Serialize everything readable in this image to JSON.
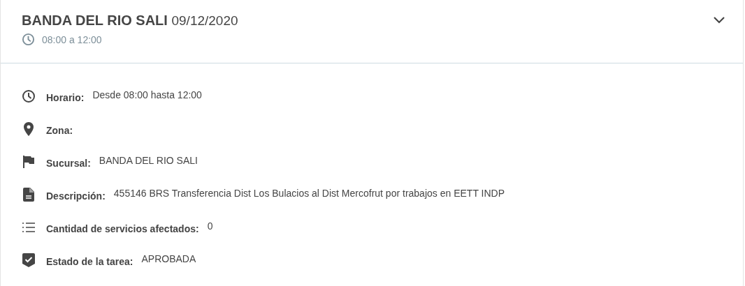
{
  "panel": {
    "title": "BANDA DEL RIO SALI",
    "date": "09/12/2020",
    "time": "08:00 a 12:00",
    "expanded": true
  },
  "details": [
    {
      "kind": "clock",
      "label": "Horario:",
      "value": "Desde 08:00 hasta 12:00"
    },
    {
      "kind": "pin",
      "label": "Zona:"
    },
    {
      "kind": "flag",
      "label": "Sucursal:",
      "value": "BANDA DEL RIO SALI"
    },
    {
      "kind": "document",
      "label": "Descripción:",
      "value": "455146 BRS Transferencia Dist Los Bulacios al Dist Mercofrut por trabajos en EETT INDP"
    },
    {
      "kind": "list",
      "label": "Cantidad de servicios afectados:",
      "value": "0"
    },
    {
      "kind": "shield",
      "label": "Estado de la tarea:",
      "value": "APROBADA"
    }
  ]
}
